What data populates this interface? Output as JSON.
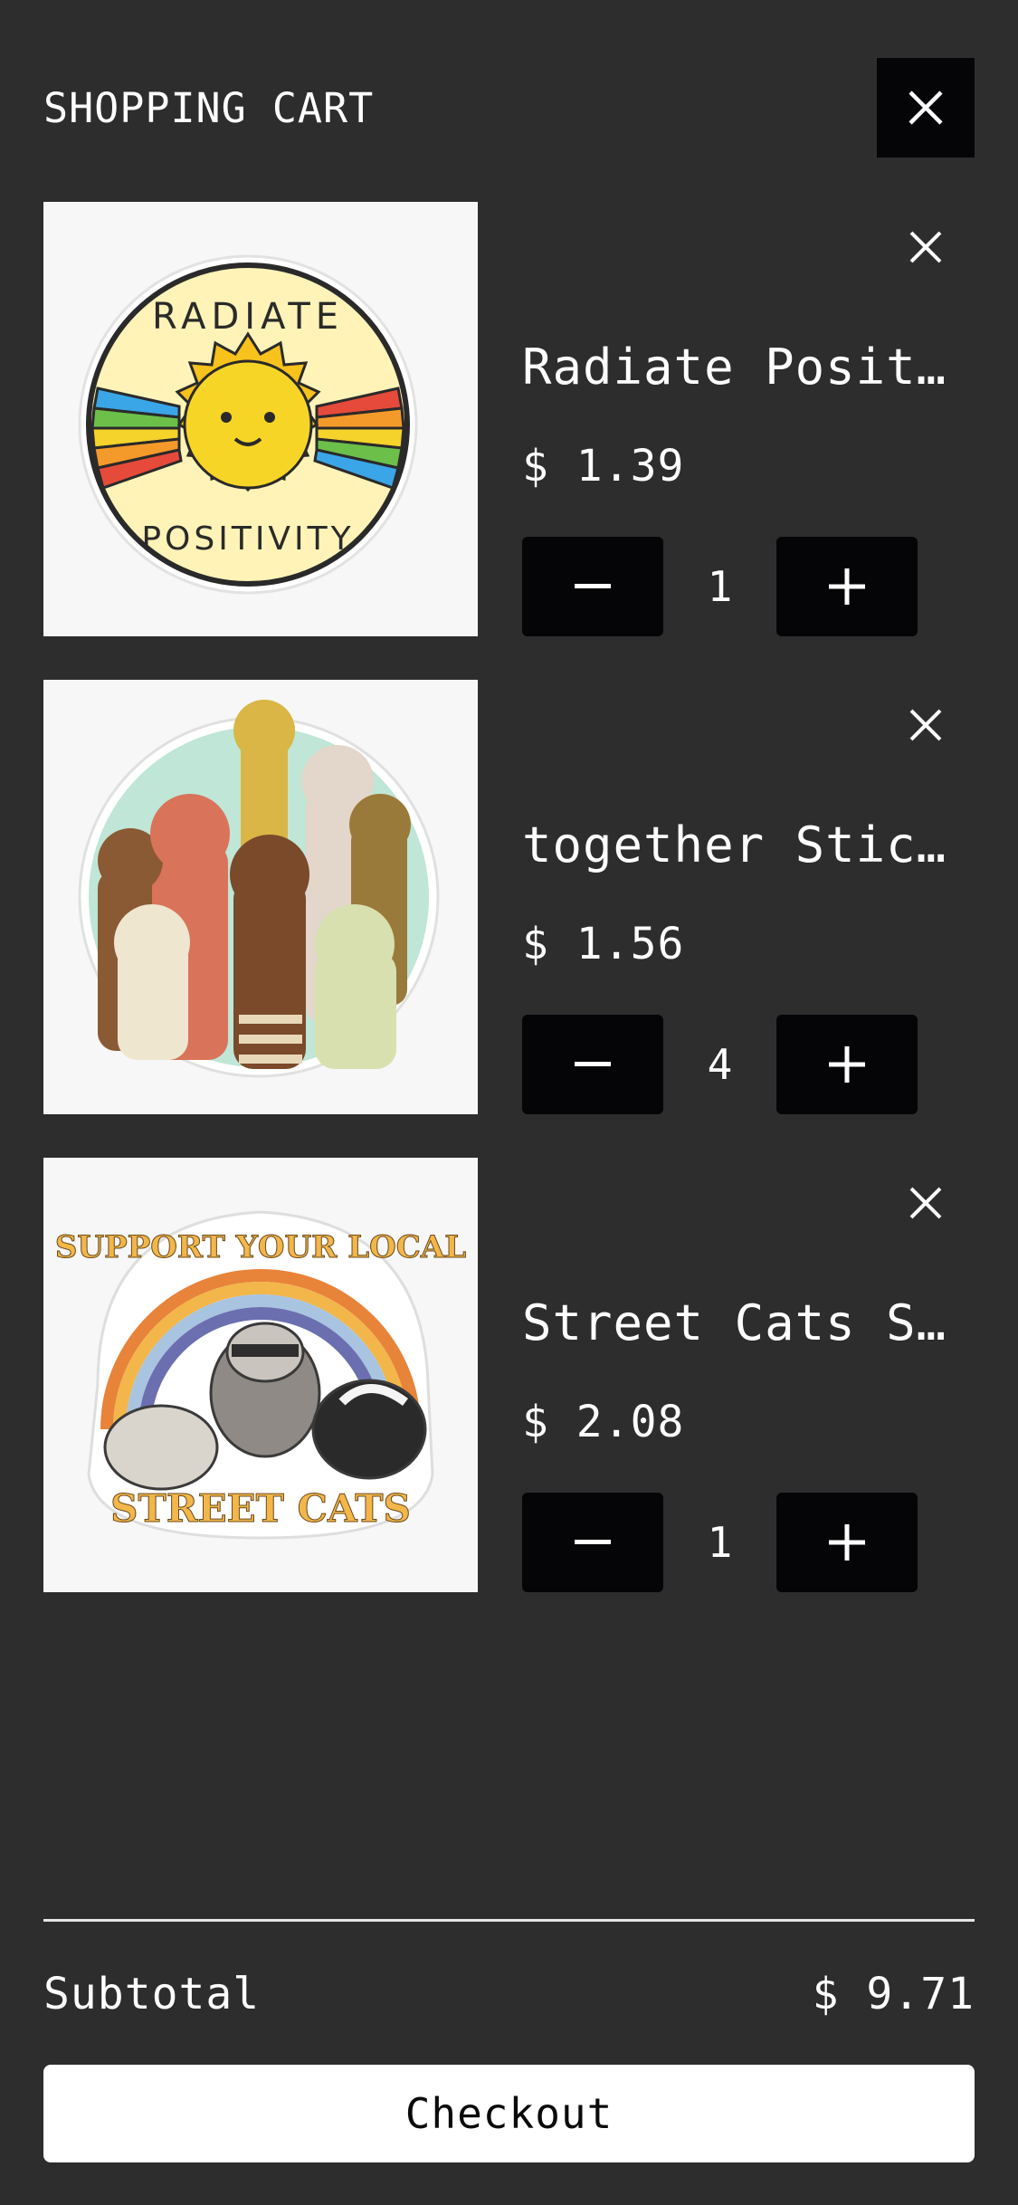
{
  "header": {
    "title": "SHOPPING CART",
    "close_icon": "close-icon"
  },
  "items": [
    {
      "name": "Radiate Positivity Sticker",
      "price": "$ 1.39",
      "quantity": "1",
      "image_text_top": "RADIATE",
      "image_text_bottom": "POSITIVITY"
    },
    {
      "name": "together Sticker",
      "price": "$ 1.56",
      "quantity": "4"
    },
    {
      "name": "Street Cats Sticker",
      "price": "$ 2.08",
      "quantity": "1",
      "image_text_top": "SUPPORT YOUR LOCAL",
      "image_text_bottom": "STREET CATS"
    }
  ],
  "summary": {
    "subtotal_label": "Subtotal",
    "subtotal_value": "$ 9.71"
  },
  "checkout_label": "Checkout",
  "colors": {
    "background": "#2d2d2e",
    "button_dark": "#050508",
    "text": "#ffffff",
    "checkout_bg": "#ffffff"
  },
  "icons": {
    "remove": "close-icon",
    "decrement": "minus-icon",
    "increment": "plus-icon"
  }
}
